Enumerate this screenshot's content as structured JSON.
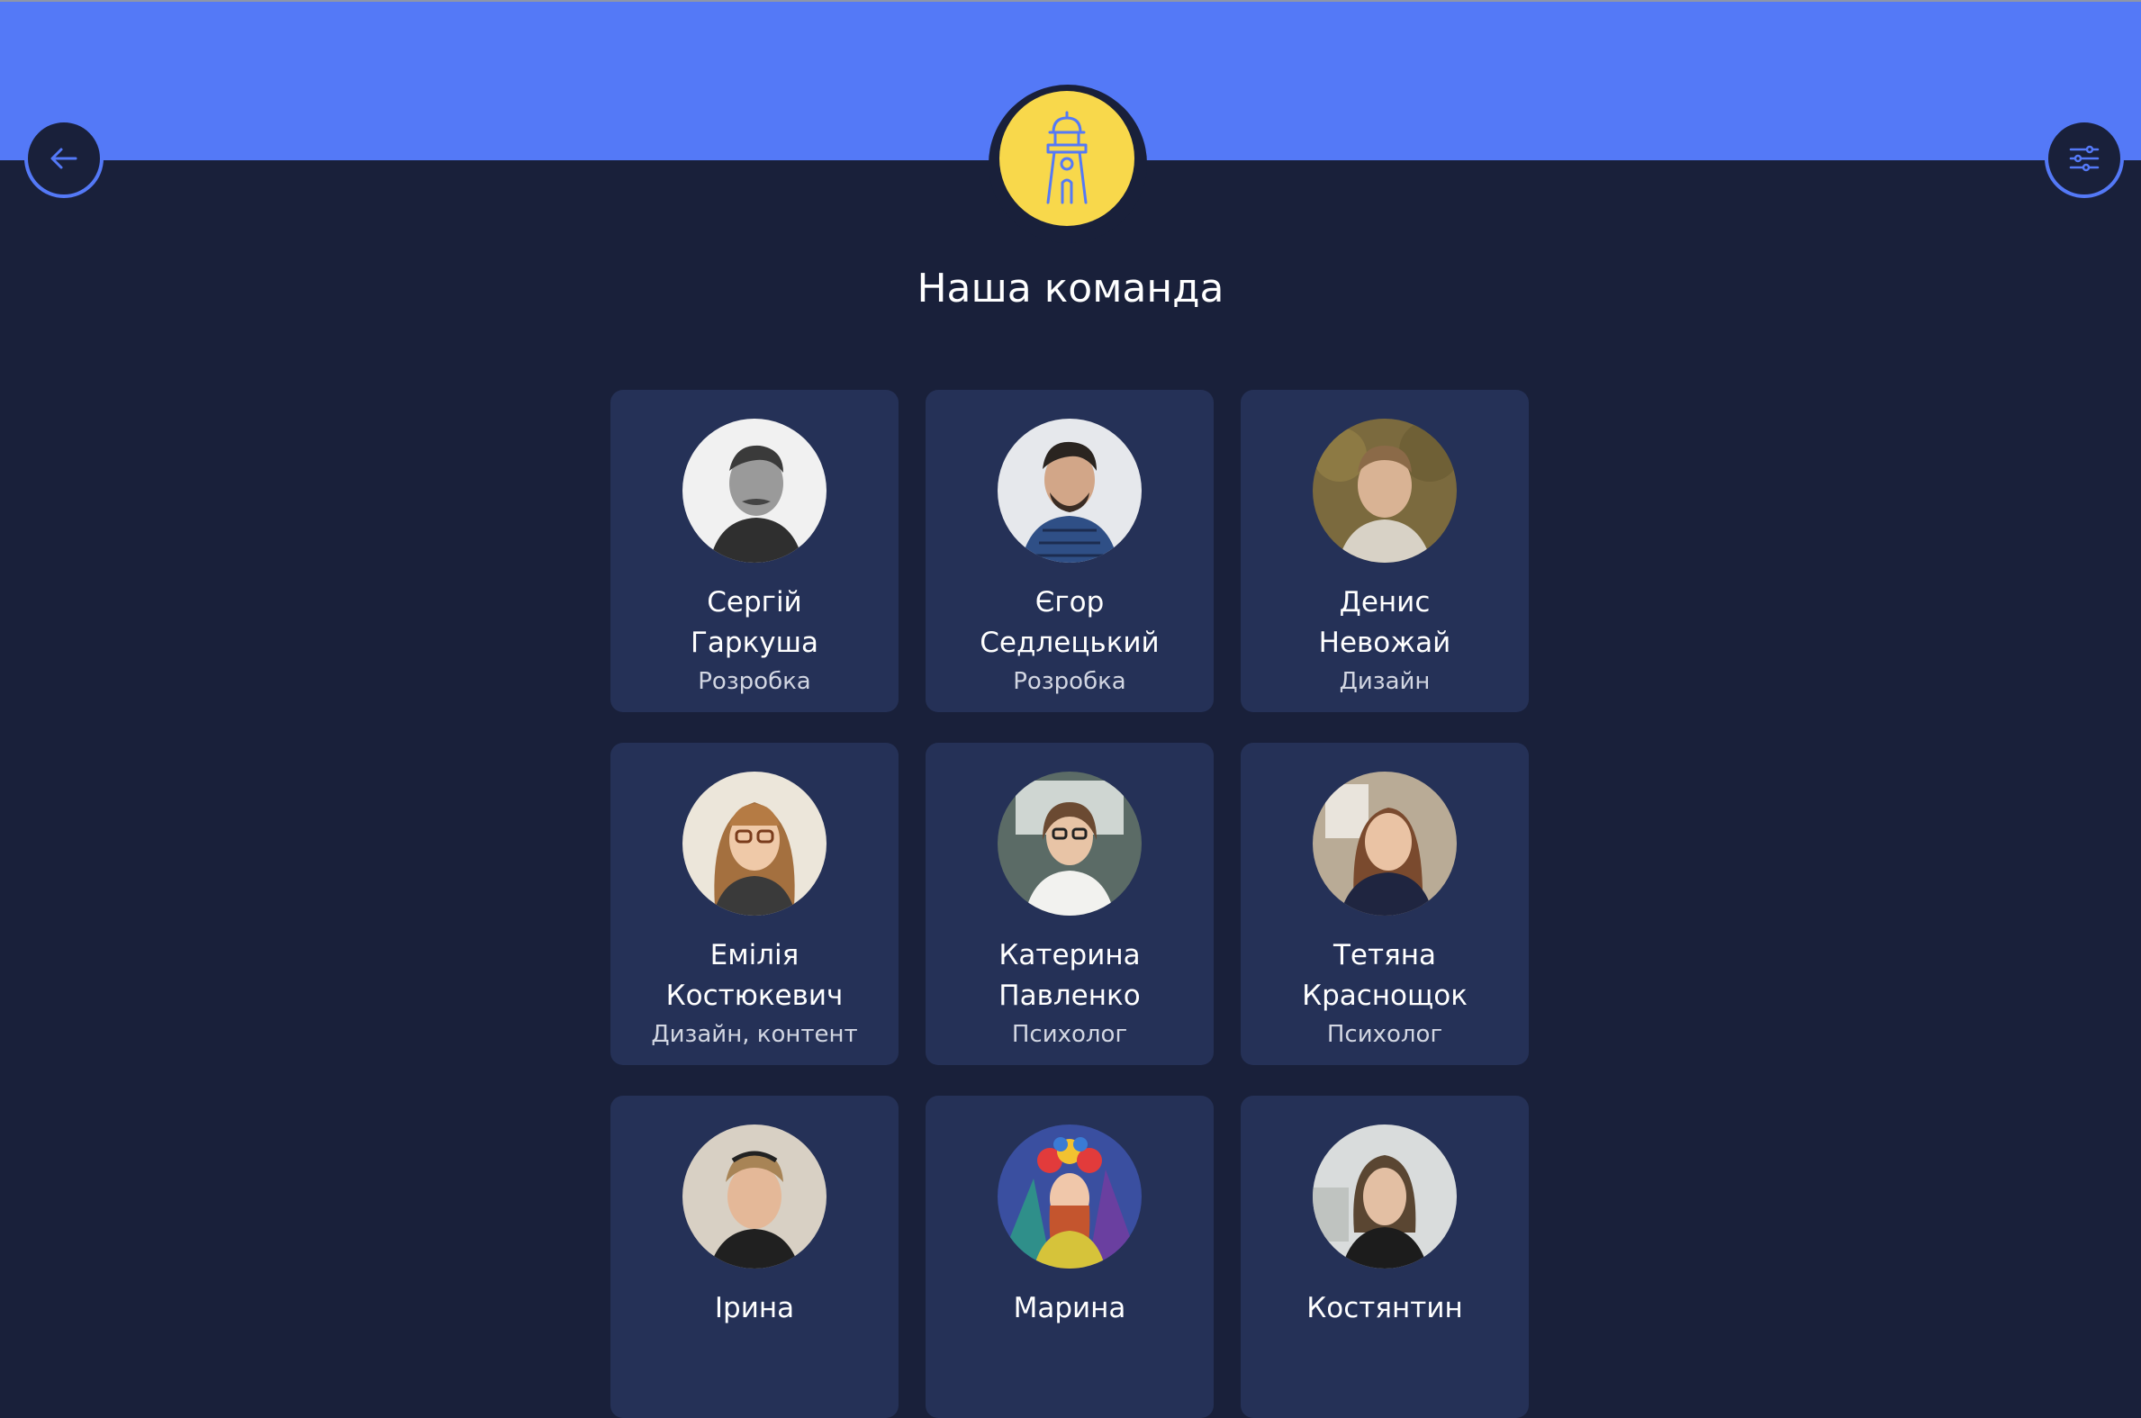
{
  "header": {
    "back_icon": "arrow-left-icon",
    "logo_icon": "lighthouse-icon",
    "filter_icon": "sliders-icon",
    "colors": {
      "bar": "#5479f7",
      "background": "#19203a",
      "card": "#253157",
      "logo": "#f8d84b"
    }
  },
  "page": {
    "title": "Наша команда"
  },
  "team": [
    {
      "first": "Сергій",
      "last": "Гаркуша",
      "role": "Розробка"
    },
    {
      "first": "Єгор",
      "last": "Седлецький",
      "role": "Розробка"
    },
    {
      "first": "Денис",
      "last": "Невожай",
      "role": "Дизайн"
    },
    {
      "first": "Емілія",
      "last": "Костюкевич",
      "role": "Дизайн, контент"
    },
    {
      "first": "Катерина",
      "last": "Павленко",
      "role": "Психолог"
    },
    {
      "first": "Тетяна",
      "last": "Краснощок",
      "role": "Психолог"
    },
    {
      "first": "Ірина",
      "last": "",
      "role": ""
    },
    {
      "first": "Марина",
      "last": "",
      "role": ""
    },
    {
      "first": "Костянтин",
      "last": "",
      "role": ""
    }
  ]
}
